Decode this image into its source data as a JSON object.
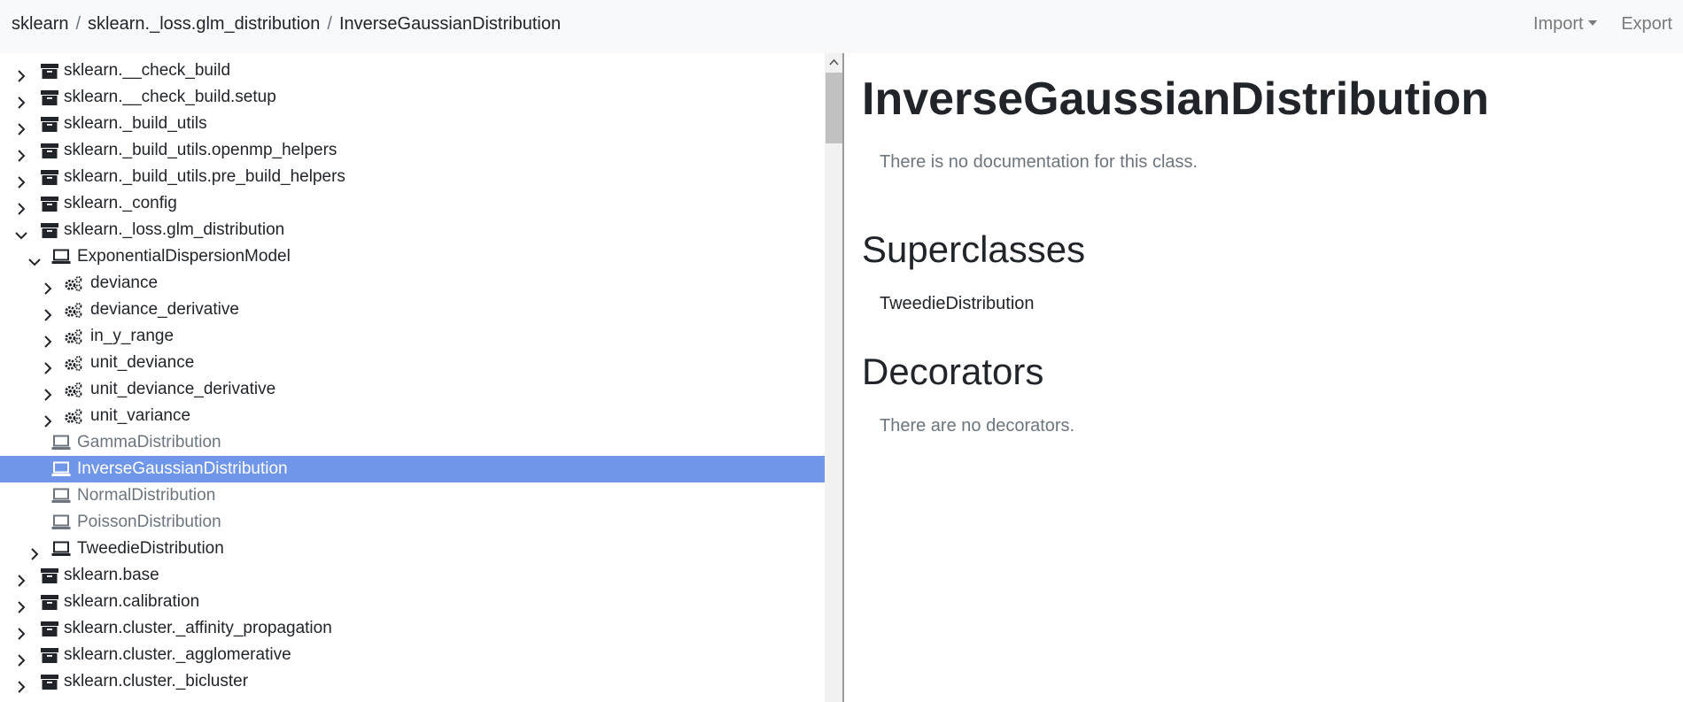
{
  "breadcrumb": [
    "sklearn",
    "sklearn._loss.glm_distribution",
    "InverseGaussianDistribution"
  ],
  "nav": {
    "import_label": "Import",
    "export_label": "Export"
  },
  "tree": [
    {
      "label": "sklearn.__check_build",
      "type": "module",
      "depth": 0,
      "chevron": "right"
    },
    {
      "label": "sklearn.__check_build.setup",
      "type": "module",
      "depth": 0,
      "chevron": "right"
    },
    {
      "label": "sklearn._build_utils",
      "type": "module",
      "depth": 0,
      "chevron": "right"
    },
    {
      "label": "sklearn._build_utils.openmp_helpers",
      "type": "module",
      "depth": 0,
      "chevron": "right"
    },
    {
      "label": "sklearn._build_utils.pre_build_helpers",
      "type": "module",
      "depth": 0,
      "chevron": "right"
    },
    {
      "label": "sklearn._config",
      "type": "module",
      "depth": 0,
      "chevron": "right"
    },
    {
      "label": "sklearn._loss.glm_distribution",
      "type": "module",
      "depth": 0,
      "chevron": "down"
    },
    {
      "label": "ExponentialDispersionModel",
      "type": "class",
      "depth": 1,
      "chevron": "down"
    },
    {
      "label": "deviance",
      "type": "function",
      "depth": 2,
      "chevron": "right"
    },
    {
      "label": "deviance_derivative",
      "type": "function",
      "depth": 2,
      "chevron": "right"
    },
    {
      "label": "in_y_range",
      "type": "function",
      "depth": 2,
      "chevron": "right"
    },
    {
      "label": "unit_deviance",
      "type": "function",
      "depth": 2,
      "chevron": "right"
    },
    {
      "label": "unit_deviance_derivative",
      "type": "function",
      "depth": 2,
      "chevron": "right"
    },
    {
      "label": "unit_variance",
      "type": "function",
      "depth": 2,
      "chevron": "right"
    },
    {
      "label": "GammaDistribution",
      "type": "class",
      "depth": 1,
      "chevron": "none",
      "muted": true
    },
    {
      "label": "InverseGaussianDistribution",
      "type": "class",
      "depth": 1,
      "chevron": "none",
      "selected": true
    },
    {
      "label": "NormalDistribution",
      "type": "class",
      "depth": 1,
      "chevron": "none",
      "muted": true
    },
    {
      "label": "PoissonDistribution",
      "type": "class",
      "depth": 1,
      "chevron": "none",
      "muted": true
    },
    {
      "label": "TweedieDistribution",
      "type": "class",
      "depth": 1,
      "chevron": "right"
    },
    {
      "label": "sklearn.base",
      "type": "module",
      "depth": 0,
      "chevron": "right"
    },
    {
      "label": "sklearn.calibration",
      "type": "module",
      "depth": 0,
      "chevron": "right"
    },
    {
      "label": "sklearn.cluster._affinity_propagation",
      "type": "module",
      "depth": 0,
      "chevron": "right"
    },
    {
      "label": "sklearn.cluster._agglomerative",
      "type": "module",
      "depth": 0,
      "chevron": "right"
    },
    {
      "label": "sklearn.cluster._bicluster",
      "type": "module",
      "depth": 0,
      "chevron": "right"
    }
  ],
  "content": {
    "title": "InverseGaussianDistribution",
    "doc_text": "There is no documentation for this class.",
    "superclasses_heading": "Superclasses",
    "superclasses": [
      "TweedieDistribution"
    ],
    "decorators_heading": "Decorators",
    "decorators_text": "There are no decorators."
  },
  "colors": {
    "selected_bg": "#6f96e8",
    "muted_text": "#6c757d",
    "navbar_bg": "#f8f9fa"
  }
}
